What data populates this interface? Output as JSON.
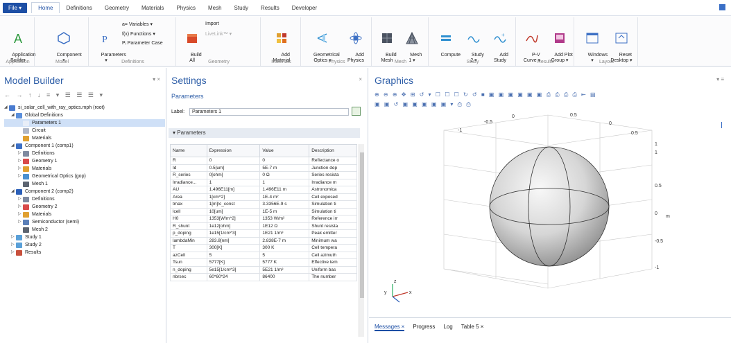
{
  "menu": {
    "file": "File ▾",
    "tabs": [
      "Home",
      "Definitions",
      "Geometry",
      "Materials",
      "Physics",
      "Mesh",
      "Study",
      "Results",
      "Developer"
    ]
  },
  "ribbon": {
    "groups": [
      {
        "title": "Application"
      },
      {
        "title": "Model"
      },
      {
        "title": "Definitions"
      },
      {
        "title": "Geometry"
      },
      {
        "title": "Materials"
      },
      {
        "title": "Physics"
      },
      {
        "title": "Mesh"
      },
      {
        "title": "Study"
      },
      {
        "title": "Results"
      },
      {
        "title": "Layout"
      }
    ],
    "app_builder": "Application\nBuilder",
    "component": "Component\n▾",
    "parameters": "Parameters\n▾",
    "variables": "a= Variables ▾",
    "functions": "f(x) Functions ▾",
    "param_case": "Pᵢ Parameter Case",
    "build_all": "Build\nAll",
    "import": "Import",
    "livelink": "LiveLink™ ▾",
    "add_material": "Add\nMaterial",
    "geom_optics": "Geometrical\nOptics ▾",
    "add_physics": "Add\nPhysics",
    "build_mesh": "Build\nMesh",
    "mesh1": "Mesh\n1 ▾",
    "compute": "Compute",
    "study2": "Study\n2 ▾",
    "add_study": "Add\nStudy",
    "pv_curve": "P-V\nCurve ▾",
    "add_plot": "Add Plot\nGroup ▾",
    "windows": "Windows\n▾",
    "reset_desktop": "Reset\nDesktop ▾"
  },
  "model_builder": {
    "title": "Model Builder",
    "tree": [
      {
        "level": 0,
        "label": "si_solar_cell_with_ray_optics.mph (root)",
        "icon_color": "#4a7bd0",
        "twisty": "◢"
      },
      {
        "level": 1,
        "label": "Global Definitions",
        "icon_color": "#5a8fdc",
        "twisty": "◢"
      },
      {
        "level": 2,
        "label": "Parameters 1",
        "icon_color": "#e8eef8",
        "twisty": "",
        "selected": true
      },
      {
        "level": 2,
        "label": "Circuit",
        "icon_color": "#b0b8c8",
        "twisty": ""
      },
      {
        "level": 2,
        "label": "Materials",
        "icon_color": "#e0a030",
        "twisty": ""
      },
      {
        "level": 1,
        "label": "Component 1 (comp1)",
        "icon_color": "#3b6fc4",
        "twisty": "◢"
      },
      {
        "level": 2,
        "label": "Definitions",
        "icon_color": "#7f8aa0",
        "twisty": "▷"
      },
      {
        "level": 2,
        "label": "Geometry 1",
        "icon_color": "#d84a4a",
        "twisty": "▷"
      },
      {
        "level": 2,
        "label": "Materials",
        "icon_color": "#e0a030",
        "twisty": "▷"
      },
      {
        "level": 2,
        "label": "Geometrical Optics (gop)",
        "icon_color": "#4a90d0",
        "twisty": "▷"
      },
      {
        "level": 2,
        "label": "Mesh 1",
        "icon_color": "#5c6470",
        "twisty": ""
      },
      {
        "level": 1,
        "label": "Component 2 (comp2)",
        "icon_color": "#2b5fb8",
        "twisty": "◢"
      },
      {
        "level": 2,
        "label": "Definitions",
        "icon_color": "#7f8aa0",
        "twisty": "▷"
      },
      {
        "level": 2,
        "label": "Geometry 2",
        "icon_color": "#d84a4a",
        "twisty": "▷"
      },
      {
        "level": 2,
        "label": "Materials",
        "icon_color": "#e0a030",
        "twisty": "▷"
      },
      {
        "level": 2,
        "label": "Semiconductor (semi)",
        "icon_color": "#5a7fb8",
        "twisty": "▷"
      },
      {
        "level": 2,
        "label": "Mesh 2",
        "icon_color": "#5c6470",
        "twisty": ""
      },
      {
        "level": 1,
        "label": "Study 1",
        "icon_color": "#5aa0d8",
        "twisty": "▷"
      },
      {
        "level": 1,
        "label": "Study 2",
        "icon_color": "#5aa0d8",
        "twisty": "▷"
      },
      {
        "level": 1,
        "label": "Results",
        "icon_color": "#c8503c",
        "twisty": "▷"
      }
    ]
  },
  "settings": {
    "title": "Settings",
    "subtitle": "Parameters",
    "label_caption": "Label:",
    "label_value": "Parameters 1",
    "section": "▾  Parameters",
    "columns": [
      "Name",
      "Expression",
      "Value",
      "Description"
    ],
    "rows": [
      [
        "R",
        "0",
        "0",
        "Reflectance o"
      ],
      [
        "Id",
        "0.5[um]",
        "5E-7 m",
        "Junction dep"
      ],
      [
        "R_series",
        "0[ohm]",
        "0 Ω",
        "Series resista"
      ],
      [
        "Irradiance...",
        "1",
        "1",
        "Irradiance m"
      ],
      [
        "AU",
        "1.496E11[m]",
        "1.496E11 m",
        "Astronomica"
      ],
      [
        "Area",
        "1[cm^2]",
        "1E-4 m²",
        "Cell exposed"
      ],
      [
        "tmax",
        "1[m]/c_const",
        "3.3356E-9 s",
        "Simulation ti"
      ],
      [
        "lcell",
        "10[um]",
        "1E-5 m",
        "Simulation ti"
      ],
      [
        "H0",
        "1353[W/m^2]",
        "1353 W/m²",
        "Reference irr"
      ],
      [
        "R_shunt",
        "1e12[ohm]",
        "1E12 Ω",
        "Shunt resista"
      ],
      [
        "p_doping",
        "1e15[1/cm^3]",
        "1E21 1/m³",
        "Peak emitter"
      ],
      [
        "lambdaMin",
        "283.8[nm]",
        "2.838E-7 m",
        "Minimum wa"
      ],
      [
        "T",
        "300[K]",
        "300 K",
        "Cell tempera"
      ],
      [
        "azCell",
        "5",
        "5",
        "Cell azimuth"
      ],
      [
        "Tsun",
        "5777[K]",
        "5777 K",
        "Effective tem"
      ],
      [
        "n_doping",
        "5e15[1/cm^3]",
        "5E21 1/m³",
        "Uniform bas"
      ],
      [
        "nbrsec",
        "60*60*24",
        "86400",
        "The number"
      ]
    ]
  },
  "graphics": {
    "title": "Graphics",
    "toolbar_1": "⊕ ⊖ ⊕ ✥ ⊞  ↺ ▾  ☐ ☐ ☐ ↻ ↺ ■  ▣ ▣ ▣ ▣ ▣ ▣  ⎙ ⎙ ⎙ ⎙  ⇤ ▤",
    "toolbar_2": "▣ ▣ ↺  ▣ ▣ ▣  ▣ ▣ ▾  ⎙ ⎙",
    "axis_top": [
      "-1",
      "-0.5",
      "0",
      "0.5",
      "0",
      "0.5",
      "1"
    ],
    "axis_right": [
      "1",
      "0.5",
      "0",
      "-0.5",
      "-1"
    ],
    "unit": "m",
    "triad": {
      "x": "x",
      "y": "y",
      "z": "z"
    }
  },
  "messages": {
    "tabs": [
      "Messages ×",
      "Progress",
      "Log",
      "Table 5 ×"
    ]
  },
  "colors": {
    "accent": "#1d4fa5",
    "title_blue": "#2f5fa8",
    "selection": "#cfe0f7"
  }
}
